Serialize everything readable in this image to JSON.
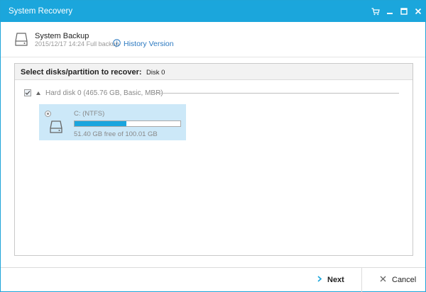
{
  "window": {
    "title": "System Recovery"
  },
  "titlebar_icons": [
    "cart-icon",
    "minimize-icon",
    "maximize-icon",
    "close-icon"
  ],
  "header": {
    "title": "System Backup",
    "subtitle": "2015/12/17 14:24 Full backup",
    "history_link": "History Version"
  },
  "panel": {
    "heading": "Select disks/partition to recover:",
    "disk_name": "Disk 0",
    "disk_row_label": "Hard disk 0 (465.76 GB, Basic, MBR)",
    "partition": {
      "name": "C: (NTFS)",
      "free_text": "51.40 GB free of 100.01 GB",
      "used_fraction": 0.49
    }
  },
  "footer": {
    "next_label": "Next",
    "cancel_label": "Cancel"
  },
  "colors": {
    "accent": "#1ba6dc",
    "selected_bg": "#cce8f8",
    "link": "#2a78c0"
  }
}
